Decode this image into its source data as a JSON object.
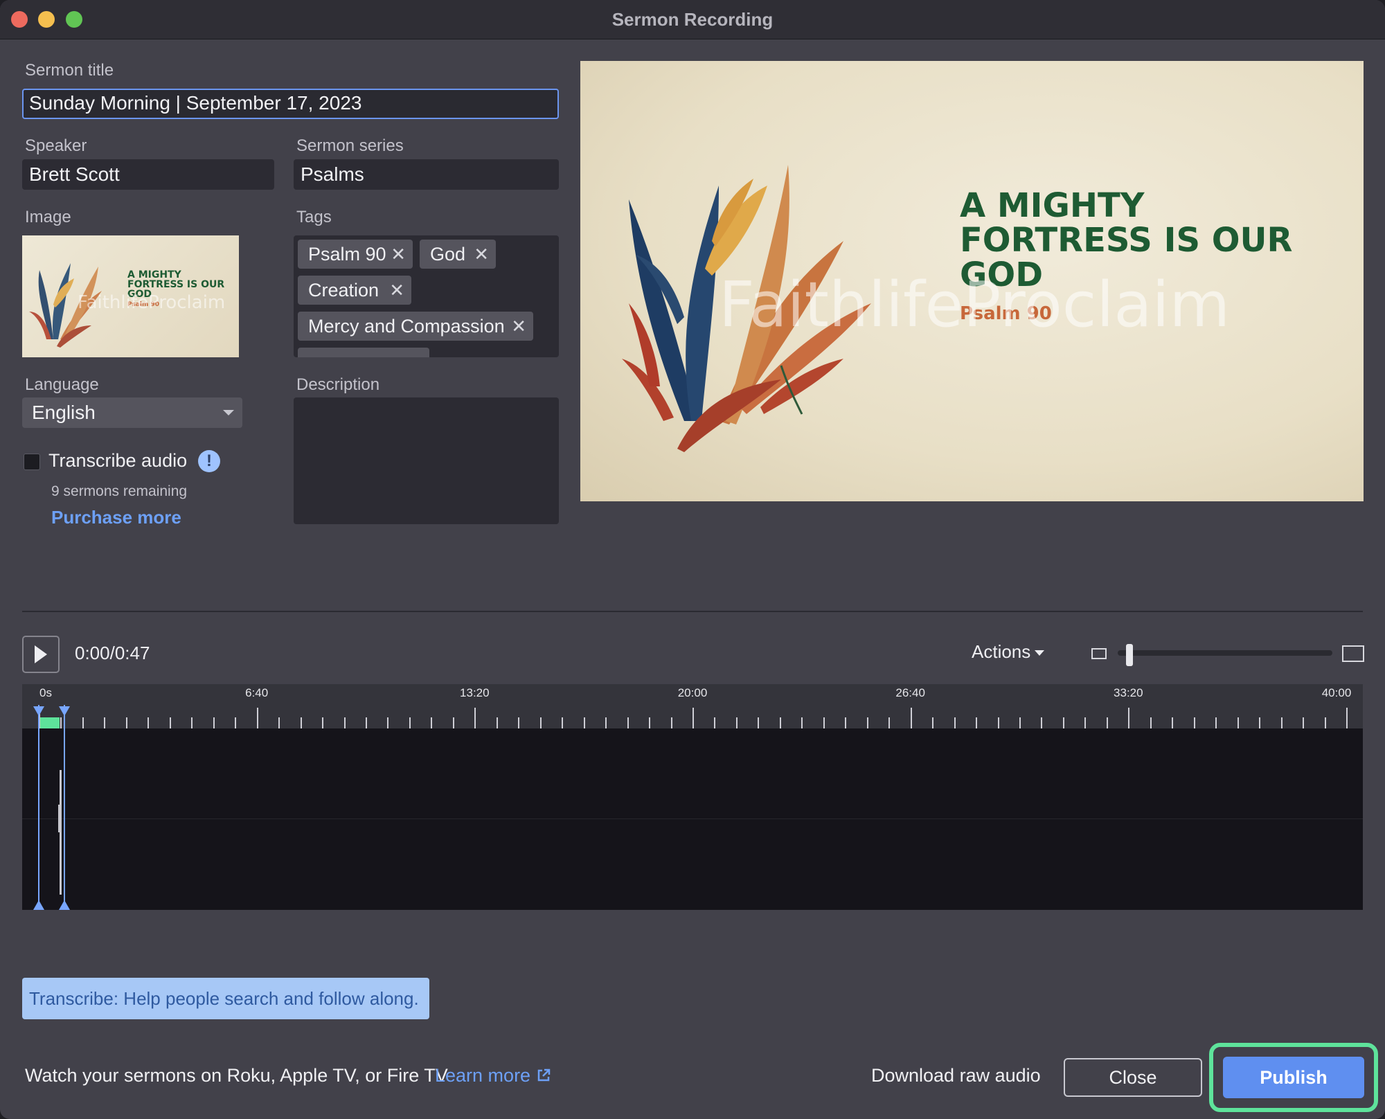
{
  "window": {
    "title": "Sermon Recording"
  },
  "form": {
    "sermon_title_label": "Sermon title",
    "sermon_title_value": "Sunday Morning | September 17, 2023",
    "speaker_label": "Speaker",
    "speaker_value": "Brett Scott",
    "series_label": "Sermon series",
    "series_value": "Psalms",
    "image_label": "Image",
    "tags_label": "Tags",
    "tags": [
      "Psalm 90",
      "God",
      "Creation",
      "Mercy and Compassion"
    ],
    "language_label": "Language",
    "language_value": "English",
    "description_label": "Description",
    "transcribe_label": "Transcribe audio",
    "sermons_remaining": "9 sermons remaining",
    "purchase_more": "Purchase more"
  },
  "preview": {
    "title_lines": [
      "A MIGHTY",
      "FORTRESS IS OUR",
      "GOD"
    ],
    "subtitle": "Psalm 90",
    "watermark": "FaithlifeProclaim"
  },
  "player": {
    "time": "0:00/0:47",
    "actions_label": "Actions",
    "zoom_level": 0.04
  },
  "timeline": {
    "labels": [
      "0s",
      "6:40",
      "13:20",
      "20:00",
      "26:40",
      "33:20",
      "40:00"
    ]
  },
  "hint": "Transcribe: Help people search and follow along.",
  "footer": {
    "watch_text": "Watch your sermons on Roku, Apple TV, or Fire TV",
    "learn_more": "Learn more",
    "download_raw_audio": "Download raw audio",
    "close": "Close",
    "publish": "Publish"
  },
  "colors": {
    "accent": "#5f8ff0",
    "highlight": "#5ee39b",
    "link": "#6da0f6"
  }
}
